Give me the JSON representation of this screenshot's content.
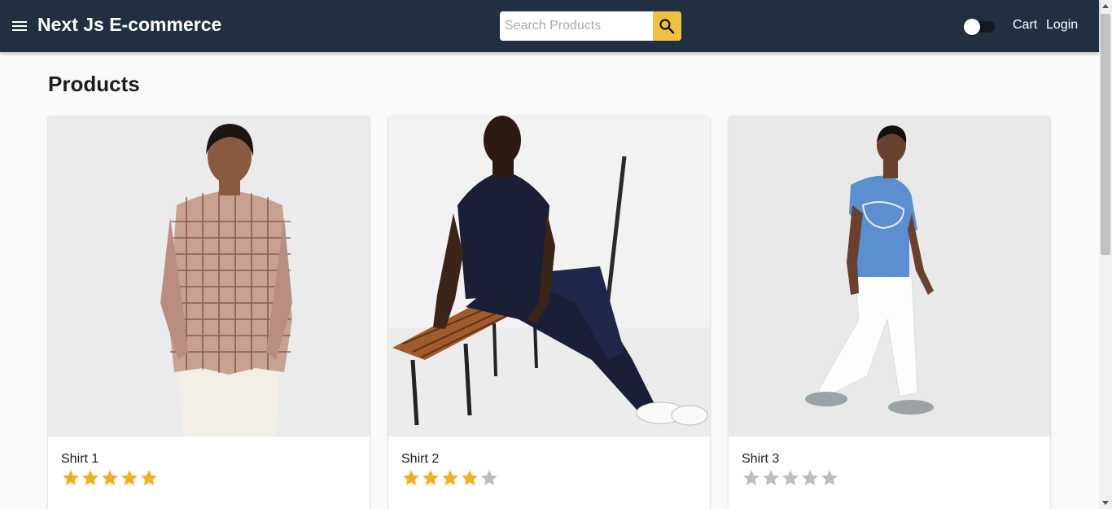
{
  "header": {
    "brand": "Next Js E-commerce",
    "search": {
      "placeholder": "Search Products",
      "value": ""
    },
    "dark_mode_on": false,
    "links": {
      "cart": "Cart",
      "login": "Login"
    }
  },
  "main": {
    "title": "Products",
    "products": [
      {
        "name": "Shirt 1",
        "rating": 5,
        "max_rating": 5
      },
      {
        "name": "Shirt 2",
        "rating": 4,
        "max_rating": 5
      },
      {
        "name": "Shirt 3",
        "rating": 0,
        "max_rating": 5
      }
    ]
  },
  "colors": {
    "appbar": "#203040",
    "search_button": "#f0c040",
    "star_filled": "#f0b020",
    "star_empty": "#bdbdbd"
  },
  "icons": [
    "menu-icon",
    "search-icon"
  ]
}
